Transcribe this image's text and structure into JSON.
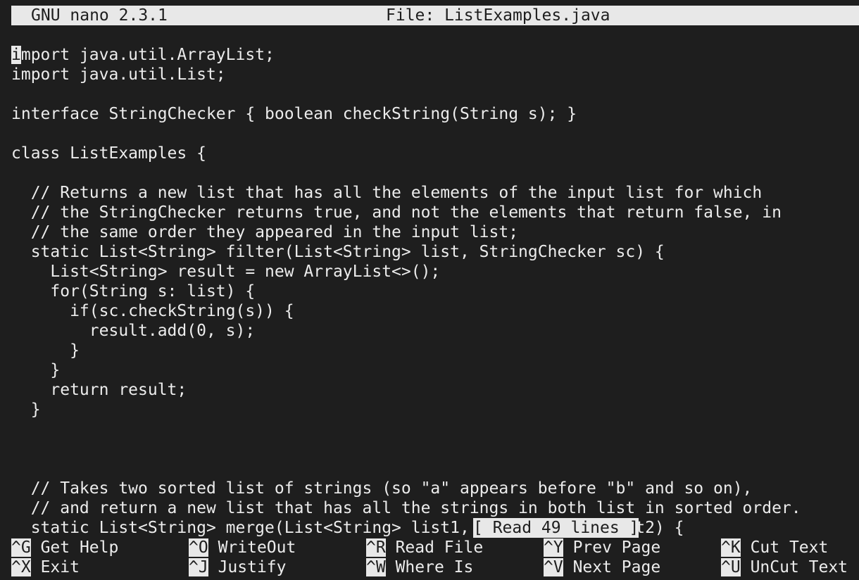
{
  "titlebar": {
    "version": "GNU nano 2.3.1",
    "file": "File: ListExamples.java"
  },
  "editor": {
    "cursor_char": "i",
    "first_line_rest": "mport java.util.ArrayList;",
    "lines": [
      "import java.util.List;",
      "",
      "interface StringChecker { boolean checkString(String s); }",
      "",
      "class ListExamples {",
      "",
      "  // Returns a new list that has all the elements of the input list for which",
      "  // the StringChecker returns true, and not the elements that return false, in",
      "  // the same order they appeared in the input list;",
      "  static List<String> filter(List<String> list, StringChecker sc) {",
      "    List<String> result = new ArrayList<>();",
      "    for(String s: list) {",
      "      if(sc.checkString(s)) {",
      "        result.add(0, s);",
      "      }",
      "    }",
      "    return result;",
      "  }",
      "",
      "",
      "",
      "  // Takes two sorted list of strings (so \"a\" appears before \"b\" and so on),",
      "  // and return a new list that has all the strings in both list in sorted order.",
      "  static List<String> merge(List<String> list1, List<String> list2) {"
    ]
  },
  "status": "[ Read 49 lines ]",
  "shortcuts": [
    {
      "key": "^G",
      "label": "Get Help"
    },
    {
      "key": "^O",
      "label": "WriteOut"
    },
    {
      "key": "^R",
      "label": "Read File"
    },
    {
      "key": "^Y",
      "label": "Prev Page"
    },
    {
      "key": "^K",
      "label": "Cut Text"
    },
    {
      "key": "^X",
      "label": "Exit"
    },
    {
      "key": "^J",
      "label": "Justify"
    },
    {
      "key": "^W",
      "label": "Where Is"
    },
    {
      "key": "^V",
      "label": "Next Page"
    },
    {
      "key": "^U",
      "label": "UnCut Text"
    }
  ],
  "colors": {
    "background": "#1e1e1e",
    "foreground": "#ececec",
    "inverse": "#e8e8e8"
  }
}
